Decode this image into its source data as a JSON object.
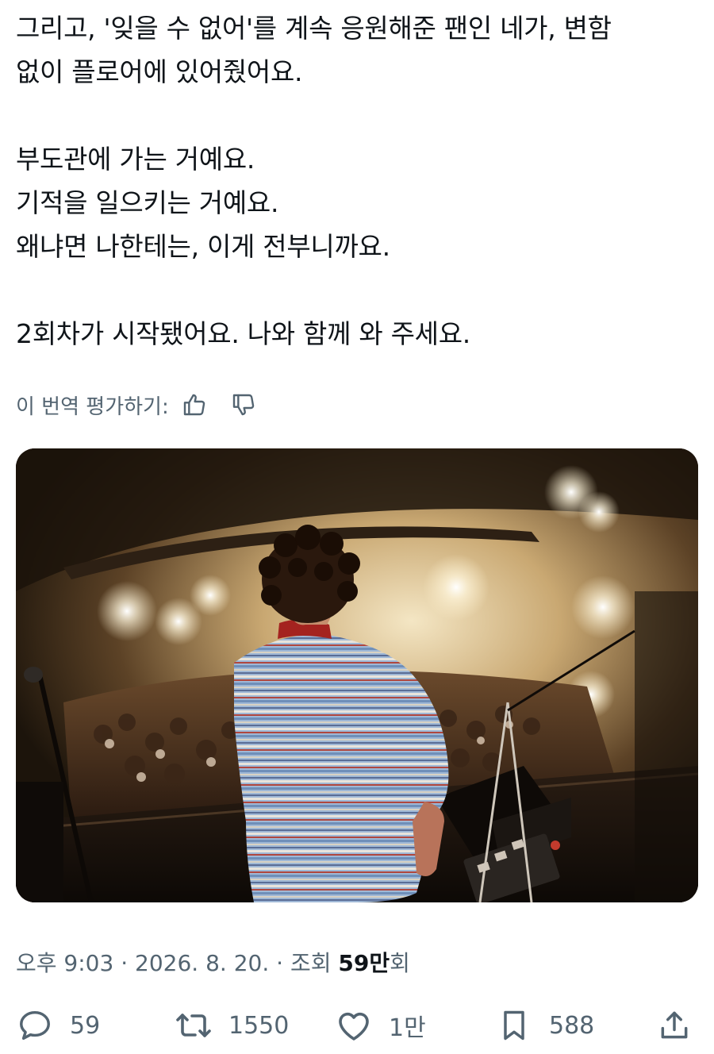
{
  "tweet": {
    "lines": [
      "그리고, '잊을 수 없어'를 계속 응원해준 팬인 네가, 변함",
      "없이 플로어에 있어줬어요.",
      "부도관에 가는 거예요.",
      "기적을 일으키는 거예요.",
      "왜냐면 나한테는, 이게 전부니까요.",
      "2회차가 시작됐어요. 나와 함께 와 주세요."
    ]
  },
  "translation": {
    "rate_label": "이 번역 평가하기:",
    "thumbs_up_icon": "thumbs-up-icon",
    "thumbs_down_icon": "thumbs-down-icon"
  },
  "media": {
    "type": "photo",
    "subject": "concert-stage-performer-facing-crowd"
  },
  "meta": {
    "time": "오후 9:03",
    "separator": "·",
    "date": "2026. 8. 20.",
    "views_label": "조회",
    "views_count": "59만",
    "views_suffix": "회"
  },
  "actions": {
    "reply": {
      "icon": "reply-icon",
      "count": "59"
    },
    "retweet": {
      "icon": "retweet-icon",
      "count": "1550"
    },
    "like": {
      "icon": "heart-icon",
      "count": "1만"
    },
    "bookmark": {
      "icon": "bookmark-icon",
      "count": "588"
    },
    "share": {
      "icon": "share-icon"
    }
  },
  "colors": {
    "text": "#0f1419",
    "secondary": "#536471"
  }
}
